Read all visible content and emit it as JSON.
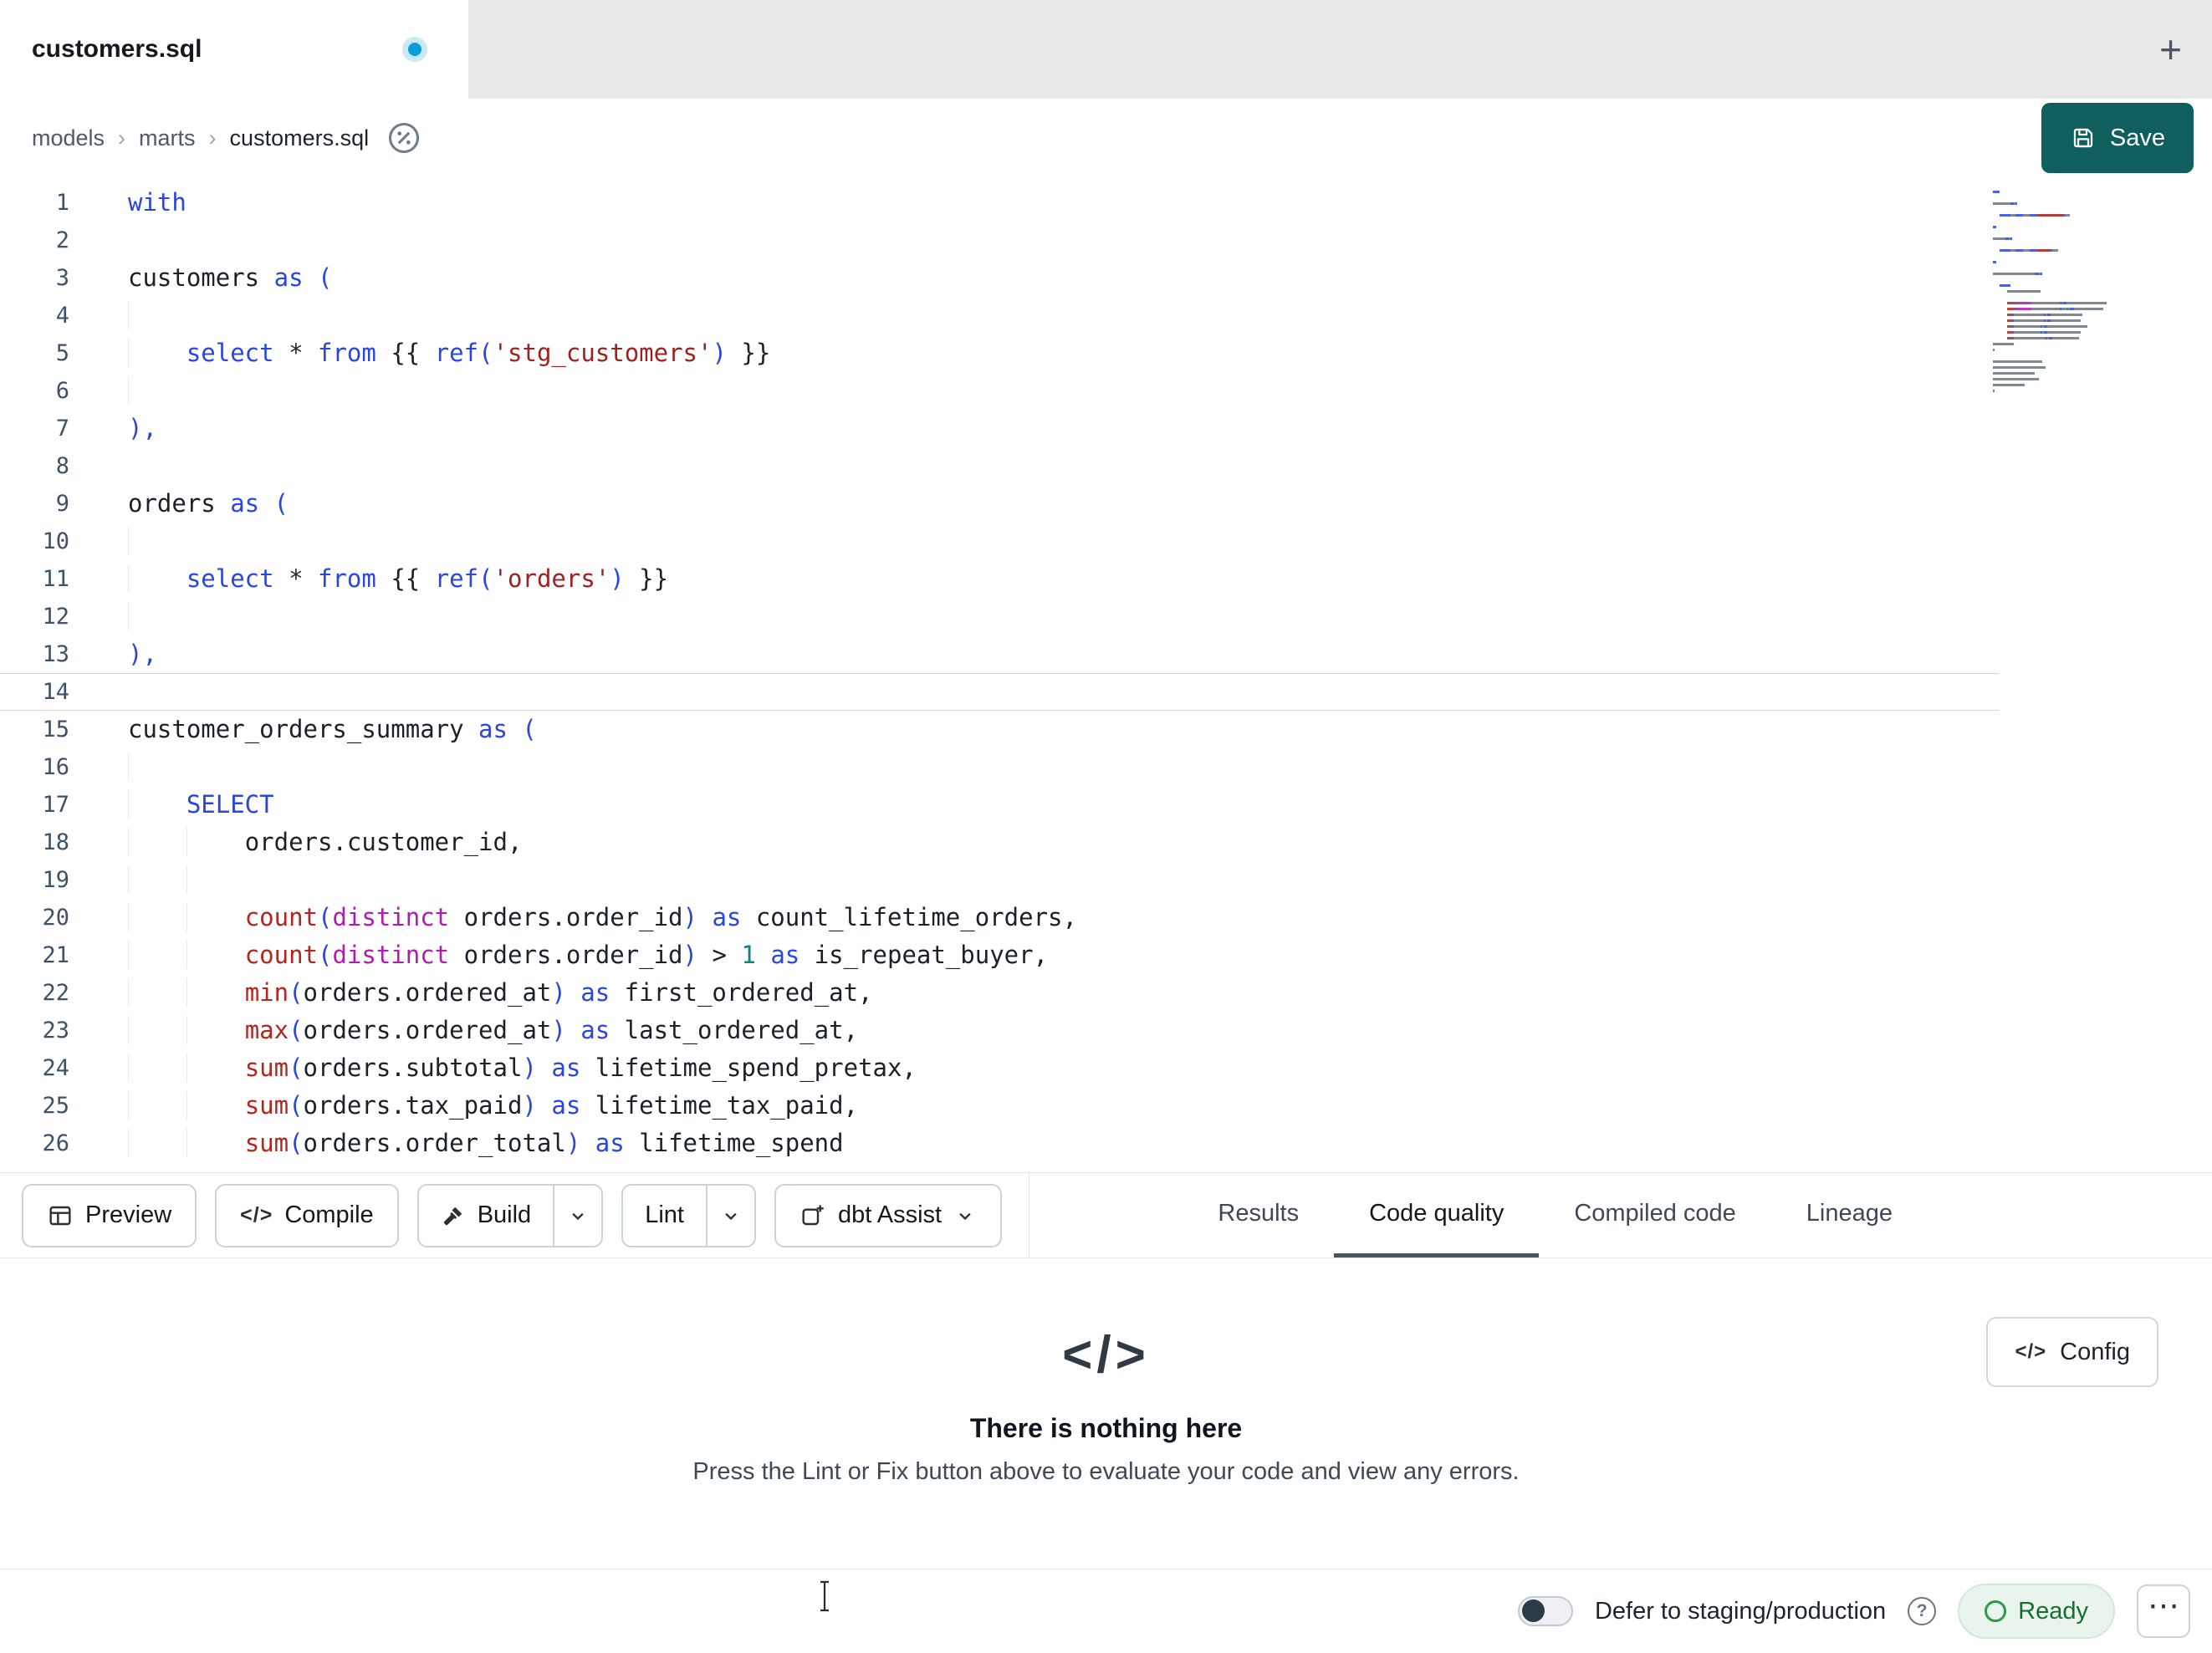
{
  "tab_bar": {
    "tab_title": "customers.sql",
    "new_tab_label": "+"
  },
  "breadcrumb": {
    "items": [
      "models",
      "marts",
      "customers.sql"
    ],
    "separator": "›"
  },
  "actions": {
    "save": "Save"
  },
  "toolbar": {
    "preview": "Preview",
    "compile": "Compile",
    "build": "Build",
    "lint": "Lint",
    "assist": "dbt Assist"
  },
  "panel_tabs": [
    {
      "label": "Results",
      "active": false
    },
    {
      "label": "Code quality",
      "active": true
    },
    {
      "label": "Compiled code",
      "active": false
    },
    {
      "label": "Lineage",
      "active": false
    }
  ],
  "empty_state": {
    "title": "There is nothing here",
    "subtitle": "Press the Lint or Fix button above to evaluate your code and view any errors.",
    "config_label": "Config"
  },
  "status_bar": {
    "defer_label": "Defer to staging/production",
    "ready_label": "Ready"
  },
  "icons": {
    "code": "</>",
    "help": "?",
    "ellipsis": "⋯"
  },
  "colors": {
    "save_button": "#0e5f5e",
    "keyword": "#2a46dd",
    "function": "#b3261e",
    "string": "#9c2121",
    "modifier": "#b21ab2",
    "number": "#0d7f8c",
    "paren": "#2a46dd",
    "ready_green": "#166e30"
  },
  "editor": {
    "current_line": 14,
    "lines": [
      {
        "n": 1,
        "tokens": [
          [
            "kw",
            "with"
          ]
        ]
      },
      {
        "n": 2,
        "tokens": []
      },
      {
        "n": 3,
        "tokens": [
          [
            "pl",
            "customers "
          ],
          [
            "kw",
            "as"
          ],
          [
            "pl",
            " "
          ],
          [
            "pn",
            "("
          ]
        ]
      },
      {
        "n": 4,
        "tokens": [
          [
            "ws",
            "    "
          ]
        ]
      },
      {
        "n": 5,
        "tokens": [
          [
            "ws",
            "    "
          ],
          [
            "kw",
            "select"
          ],
          [
            "pl",
            " "
          ],
          [
            "op",
            "*"
          ],
          [
            "pl",
            " "
          ],
          [
            "kw",
            "from"
          ],
          [
            "pl",
            " {{ "
          ],
          [
            "kw",
            "ref"
          ],
          [
            "pn",
            "("
          ],
          [
            "st",
            "'stg_customers'"
          ],
          [
            "pn",
            ")"
          ],
          [
            "pl",
            " }}"
          ]
        ]
      },
      {
        "n": 6,
        "tokens": [
          [
            "ws",
            "    "
          ]
        ]
      },
      {
        "n": 7,
        "tokens": [
          [
            "pn",
            "),"
          ]
        ]
      },
      {
        "n": 8,
        "tokens": []
      },
      {
        "n": 9,
        "tokens": [
          [
            "pl",
            "orders "
          ],
          [
            "kw",
            "as"
          ],
          [
            "pl",
            " "
          ],
          [
            "pn",
            "("
          ]
        ]
      },
      {
        "n": 10,
        "tokens": [
          [
            "ws",
            "    "
          ]
        ]
      },
      {
        "n": 11,
        "tokens": [
          [
            "ws",
            "    "
          ],
          [
            "kw",
            "select"
          ],
          [
            "pl",
            " "
          ],
          [
            "op",
            "*"
          ],
          [
            "pl",
            " "
          ],
          [
            "kw",
            "from"
          ],
          [
            "pl",
            " {{ "
          ],
          [
            "kw",
            "ref"
          ],
          [
            "pn",
            "("
          ],
          [
            "st",
            "'orders'"
          ],
          [
            "pn",
            ")"
          ],
          [
            "pl",
            " }}"
          ]
        ]
      },
      {
        "n": 12,
        "tokens": [
          [
            "ws",
            "    "
          ]
        ]
      },
      {
        "n": 13,
        "tokens": [
          [
            "pn",
            "),"
          ]
        ]
      },
      {
        "n": 14,
        "tokens": []
      },
      {
        "n": 15,
        "tokens": [
          [
            "pl",
            "customer_orders_summary "
          ],
          [
            "kw",
            "as"
          ],
          [
            "pl",
            " "
          ],
          [
            "pn",
            "("
          ]
        ]
      },
      {
        "n": 16,
        "tokens": [
          [
            "ws",
            "    "
          ]
        ]
      },
      {
        "n": 17,
        "tokens": [
          [
            "ws",
            "    "
          ],
          [
            "kw",
            "SELECT"
          ]
        ]
      },
      {
        "n": 18,
        "tokens": [
          [
            "ws",
            "    "
          ],
          [
            "ws",
            "    "
          ],
          [
            "pl",
            "orders.customer_id,"
          ]
        ]
      },
      {
        "n": 19,
        "tokens": [
          [
            "ws",
            "    "
          ],
          [
            "ws",
            "    "
          ]
        ]
      },
      {
        "n": 20,
        "tokens": [
          [
            "ws",
            "    "
          ],
          [
            "ws",
            "    "
          ],
          [
            "fn",
            "count"
          ],
          [
            "pn",
            "("
          ],
          [
            "mg",
            "distinct"
          ],
          [
            "pl",
            " orders.order_id"
          ],
          [
            "pn",
            ")"
          ],
          [
            "pl",
            " "
          ],
          [
            "kw",
            "as"
          ],
          [
            "pl",
            " count_lifetime_orders,"
          ]
        ]
      },
      {
        "n": 21,
        "tokens": [
          [
            "ws",
            "    "
          ],
          [
            "ws",
            "    "
          ],
          [
            "fn",
            "count"
          ],
          [
            "pn",
            "("
          ],
          [
            "mg",
            "distinct"
          ],
          [
            "pl",
            " orders.order_id"
          ],
          [
            "pn",
            ")"
          ],
          [
            "pl",
            " > "
          ],
          [
            "nm",
            "1"
          ],
          [
            "pl",
            " "
          ],
          [
            "kw",
            "as"
          ],
          [
            "pl",
            " is_repeat_buyer,"
          ]
        ]
      },
      {
        "n": 22,
        "tokens": [
          [
            "ws",
            "    "
          ],
          [
            "ws",
            "    "
          ],
          [
            "fn",
            "min"
          ],
          [
            "pn",
            "("
          ],
          [
            "pl",
            "orders.ordered_at"
          ],
          [
            "pn",
            ")"
          ],
          [
            "pl",
            " "
          ],
          [
            "kw",
            "as"
          ],
          [
            "pl",
            " first_ordered_at,"
          ]
        ]
      },
      {
        "n": 23,
        "tokens": [
          [
            "ws",
            "    "
          ],
          [
            "ws",
            "    "
          ],
          [
            "fn",
            "max"
          ],
          [
            "pn",
            "("
          ],
          [
            "pl",
            "orders.ordered_at"
          ],
          [
            "pn",
            ")"
          ],
          [
            "pl",
            " "
          ],
          [
            "kw",
            "as"
          ],
          [
            "pl",
            " last_ordered_at,"
          ]
        ]
      },
      {
        "n": 24,
        "tokens": [
          [
            "ws",
            "    "
          ],
          [
            "ws",
            "    "
          ],
          [
            "fn",
            "sum"
          ],
          [
            "pn",
            "("
          ],
          [
            "pl",
            "orders.subtotal"
          ],
          [
            "pn",
            ")"
          ],
          [
            "pl",
            " "
          ],
          [
            "kw",
            "as"
          ],
          [
            "pl",
            " lifetime_spend_pretax,"
          ]
        ]
      },
      {
        "n": 25,
        "tokens": [
          [
            "ws",
            "    "
          ],
          [
            "ws",
            "    "
          ],
          [
            "fn",
            "sum"
          ],
          [
            "pn",
            "("
          ],
          [
            "pl",
            "orders.tax_paid"
          ],
          [
            "pn",
            ")"
          ],
          [
            "pl",
            " "
          ],
          [
            "kw",
            "as"
          ],
          [
            "pl",
            " lifetime_tax_paid,"
          ]
        ]
      },
      {
        "n": 26,
        "tokens": [
          [
            "ws",
            "    "
          ],
          [
            "ws",
            "    "
          ],
          [
            "fn",
            "sum"
          ],
          [
            "pn",
            "("
          ],
          [
            "pl",
            "orders.order_total"
          ],
          [
            "pn",
            ")"
          ],
          [
            "pl",
            " "
          ],
          [
            "kw",
            "as"
          ],
          [
            "pl",
            " lifetime_spend"
          ]
        ]
      }
    ],
    "minimap_extra_lengths": [
      12,
      1,
      0,
      28,
      30,
      24,
      26,
      18,
      1,
      0
    ]
  }
}
